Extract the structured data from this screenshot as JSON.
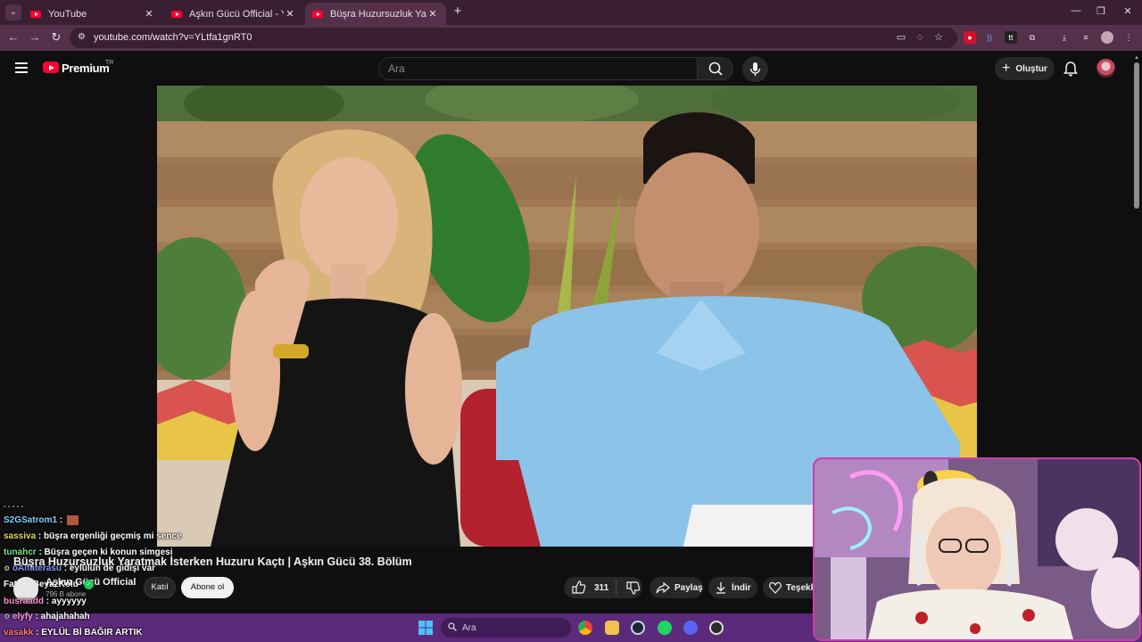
{
  "browser": {
    "tabs": [
      {
        "title": "YouTube",
        "active": false
      },
      {
        "title": "Aşkın Gücü Official - YouTube",
        "active": false
      },
      {
        "title": "Büşra Huzursuzluk Yaratmak İst",
        "active": true
      }
    ],
    "url": "youtube.com/watch?v=YLtfa1gnRT0",
    "accent": "#55304b"
  },
  "youtube": {
    "brand": "Premium",
    "country": "TR",
    "search_placeholder": "Ara",
    "create_label": "Oluştur"
  },
  "video": {
    "title": "Büşra Huzursuzluk Yaratmak İsterken Huzuru Kaçtı | Aşkın Gücü 38. Bölüm",
    "channel": "Aşkın Gücü Official",
    "subscribers": "796 B abone",
    "join_label": "Katıl",
    "subscribe_label": "Abone ol",
    "likes": "311",
    "share_label": "Paylaş",
    "download_label": "İndir",
    "thanks_label": "Teşekk"
  },
  "chat": {
    "separator": "- - - - -",
    "messages": [
      {
        "user": "S2GSatrom1",
        "text": "",
        "color": "#7fd3ff"
      },
      {
        "user": "sassiva",
        "text": "büşra ergenliği geçmiş mi sence",
        "color": "#e8d25a"
      },
      {
        "user": "tunahcr",
        "text": "Büşra geçen ki konun simgesi",
        "color": "#7ee07e"
      },
      {
        "user": "oAlfaterasu",
        "text": "eylülün de gidişi var",
        "color": "#7f9bff"
      },
      {
        "user": "FatihinBeyazKolu",
        "text": "",
        "color": "#ffffff"
      },
      {
        "user": "busraadd",
        "text": "ayyyyyy",
        "color": "#ff8fd2"
      },
      {
        "user": "elyfy",
        "text": "ahajahahah",
        "color": "#ff9ee8"
      },
      {
        "user": "vasakk",
        "text": "EYLÜL Bİ BAĞIR ARTIK",
        "color": "#ff7b7b"
      }
    ]
  },
  "taskbar": {
    "search_placeholder": "Ara"
  }
}
